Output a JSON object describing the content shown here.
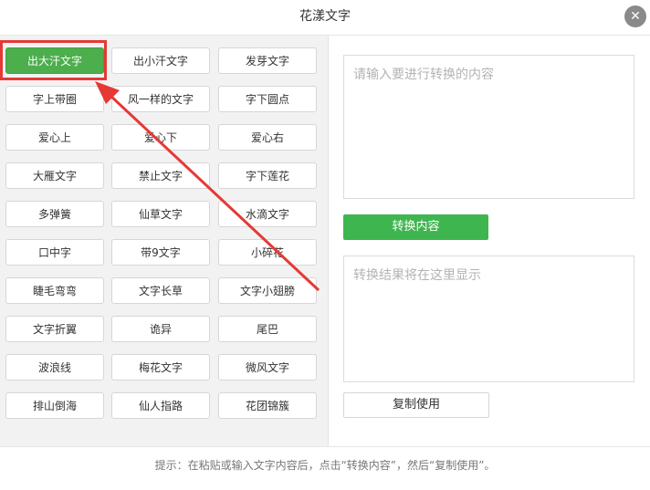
{
  "window": {
    "title": "花漾文字",
    "close_icon": "close-icon"
  },
  "styles": [
    "出大汗文字",
    "出小汗文字",
    "发芽文字",
    "字上带圈",
    "风一样的文字",
    "字下圆点",
    "爱心上",
    "爱心下",
    "爱心右",
    "大雁文字",
    "禁止文字",
    "字下莲花",
    "多弹簧",
    "仙草文字",
    "水滴文字",
    "口中字",
    "带9文字",
    "小碎花",
    "睫毛弯弯",
    "文字长草",
    "文字小翅膀",
    "文字折翼",
    "诡异",
    "尾巴",
    "波浪线",
    "梅花文字",
    "微风文字",
    "排山倒海",
    "仙人指路",
    "花团锦簇"
  ],
  "active_style_index": 0,
  "input": {
    "placeholder": "请输入要进行转换的内容"
  },
  "convert_button": "转换内容",
  "output": {
    "placeholder": "转换结果将在这里显示"
  },
  "copy_button": "复制使用",
  "footer": {
    "hint": "提示：在粘贴或输入文字内容后，点击“转换内容”，然后“复制使用”。"
  },
  "colors": {
    "accent": "#3fb550",
    "annotation": "#e53935"
  }
}
